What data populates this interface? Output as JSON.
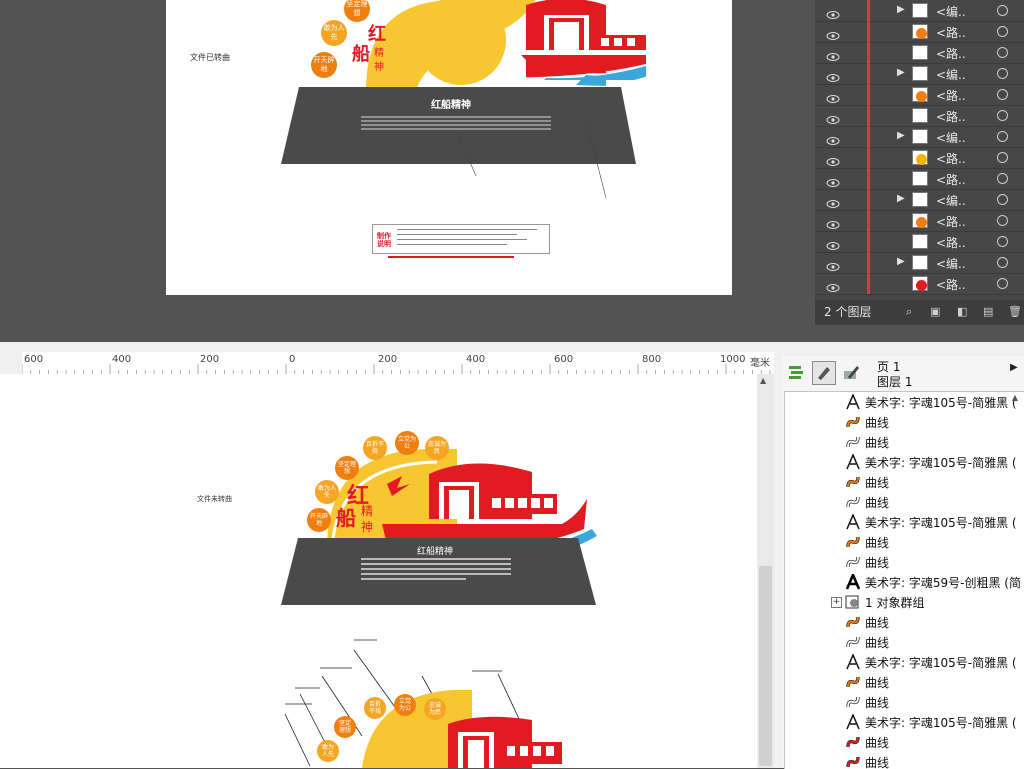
{
  "top_artboard": {
    "file_note": "文件已转曲",
    "panel_title": "红船精神",
    "labels": {
      "top1": "坚定理想",
      "left1": "敢为人先",
      "left2": "开天辟地",
      "brand1": "红",
      "brand2": "船",
      "brand3": "精",
      "brand4": "神"
    },
    "note_box_title": "制作说明"
  },
  "layers_panel": {
    "count_label": "2 个图层",
    "rows": [
      {
        "name": "<编..",
        "thumb_dot": "",
        "expand": true
      },
      {
        "name": "<路..",
        "thumb_dot": "#f07f12",
        "expand": false
      },
      {
        "name": "<路..",
        "thumb_dot": "",
        "expand": false
      },
      {
        "name": "<编..",
        "thumb_dot": "",
        "expand": true
      },
      {
        "name": "<路..",
        "thumb_dot": "#f07f12",
        "expand": false
      },
      {
        "name": "<路..",
        "thumb_dot": "",
        "expand": false
      },
      {
        "name": "<编..",
        "thumb_dot": "",
        "expand": true
      },
      {
        "name": "<路..",
        "thumb_dot": "#f4b400",
        "expand": false
      },
      {
        "name": "<路..",
        "thumb_dot": "",
        "expand": false
      },
      {
        "name": "<编..",
        "thumb_dot": "",
        "expand": true
      },
      {
        "name": "<路..",
        "thumb_dot": "#f07f12",
        "expand": false
      },
      {
        "name": "<路..",
        "thumb_dot": "",
        "expand": false
      },
      {
        "name": "<编..",
        "thumb_dot": "",
        "expand": true
      },
      {
        "name": "<路..",
        "thumb_dot": "#e21a22",
        "expand": false
      }
    ]
  },
  "ruler": {
    "ticks": [
      "600",
      "400",
      "200",
      "0",
      "200",
      "400",
      "600",
      "800",
      "1000"
    ],
    "unit": "毫米"
  },
  "object_panel": {
    "page": "页 1",
    "layer": "图层 1",
    "items": [
      {
        "text": "美术字: 字魂105号-简雅黑 (",
        "icon": "text"
      },
      {
        "text": "曲线",
        "icon": "curve-orange"
      },
      {
        "text": "曲线",
        "icon": "curve-white"
      },
      {
        "text": "美术字: 字魂105号-简雅黑 (",
        "icon": "text"
      },
      {
        "text": "曲线",
        "icon": "curve-orange"
      },
      {
        "text": "曲线",
        "icon": "curve-white"
      },
      {
        "text": "美术字: 字魂105号-简雅黑 (",
        "icon": "text"
      },
      {
        "text": "曲线",
        "icon": "curve-orange"
      },
      {
        "text": "曲线",
        "icon": "curve-white"
      },
      {
        "text": "美术字: 字魂59号-创粗黑 (简",
        "icon": "text-bold"
      },
      {
        "text": "1 对象群组",
        "icon": "group"
      },
      {
        "text": "曲线",
        "icon": "curve-orange"
      },
      {
        "text": "曲线",
        "icon": "curve-white"
      },
      {
        "text": "美术字: 字魂105号-简雅黑 (",
        "icon": "text"
      },
      {
        "text": "曲线",
        "icon": "curve-orange"
      },
      {
        "text": "曲线",
        "icon": "curve-white"
      },
      {
        "text": "美术字: 字魂105号-简雅黑 (",
        "icon": "text"
      },
      {
        "text": "曲线",
        "icon": "curve-red"
      },
      {
        "text": "曲线",
        "icon": "curve-red"
      }
    ]
  },
  "doc_canvas": {
    "file_note": "文件未转曲",
    "panel_title": "红船精神",
    "circles": [
      {
        "label": "开天辟地",
        "color": "#f07f12"
      },
      {
        "label": "敢为人先",
        "color": "#f4a623"
      },
      {
        "label": "坚定理想",
        "color": "#f07f12"
      },
      {
        "label": "百折不挠",
        "color": "#f4a623"
      },
      {
        "label": "立党为公",
        "color": "#f07f12"
      },
      {
        "label": "忠诚为民",
        "color": "#f4a623"
      }
    ],
    "brand": [
      "红",
      "船",
      "精",
      "神"
    ]
  },
  "colors": {
    "red": "#e21a22",
    "orange": "#f07f12",
    "yellow": "#f8c630",
    "dark_panel": "#4a4a4a",
    "blue_wave": "#3aa6dc"
  }
}
